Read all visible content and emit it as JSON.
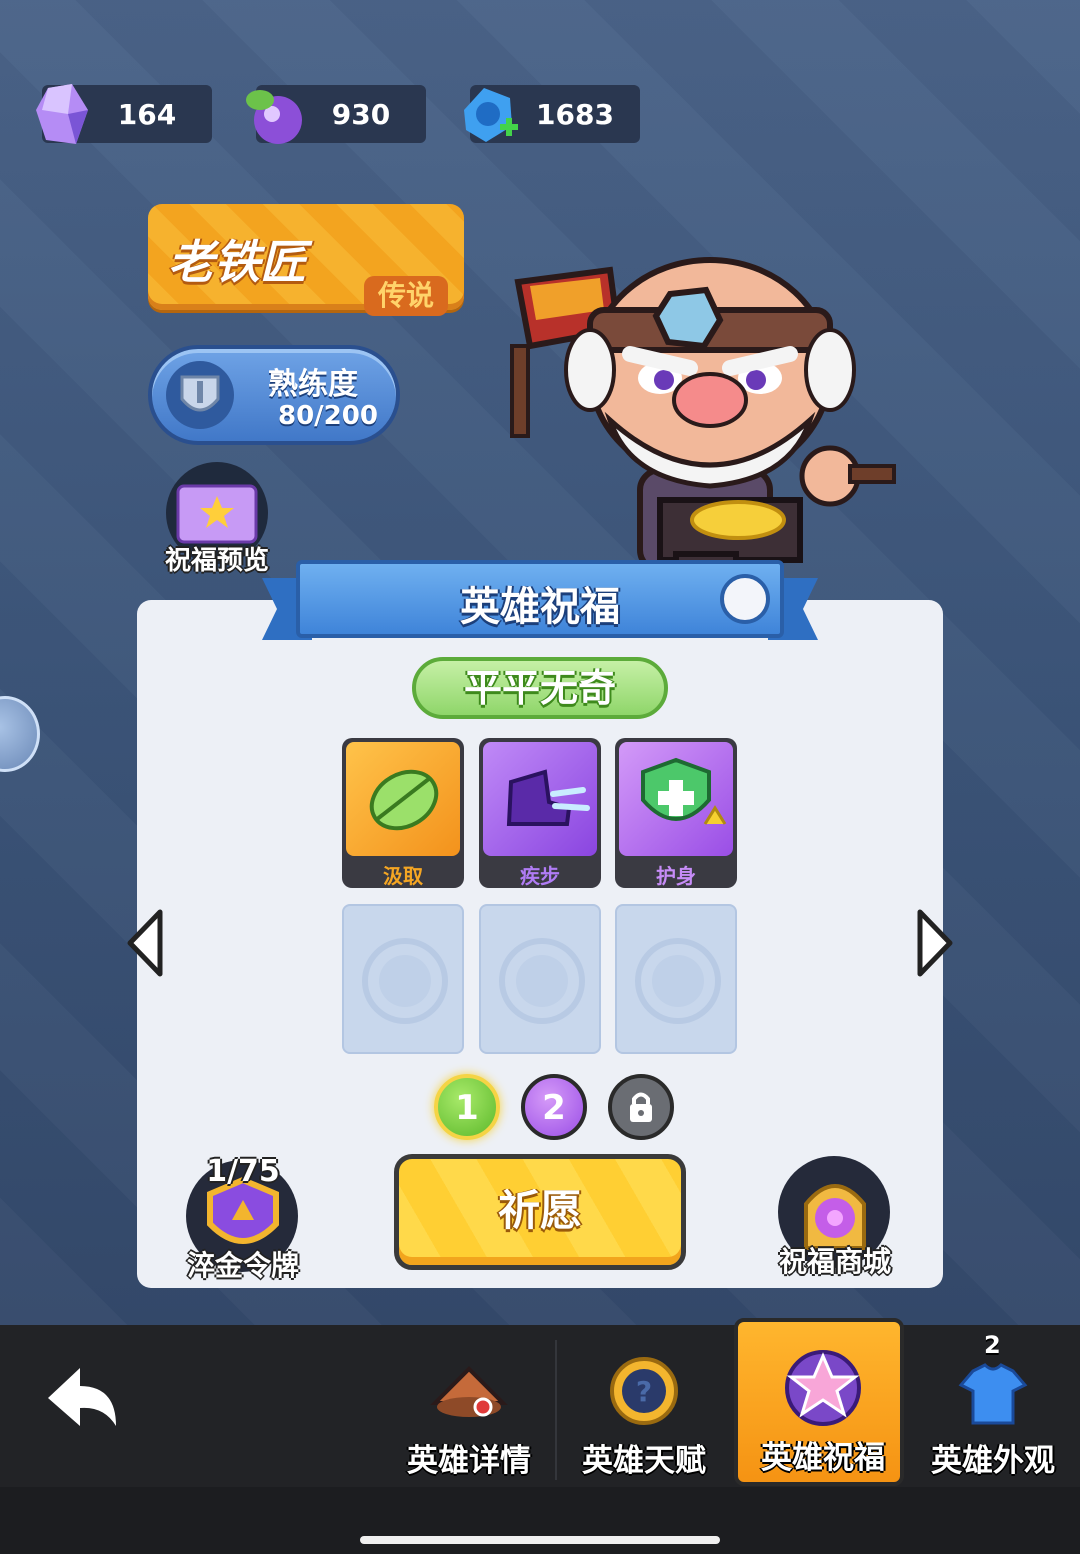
{
  "currencies": [
    {
      "icon": "crystal-icon",
      "value": "164"
    },
    {
      "icon": "potion-icon",
      "value": "930"
    },
    {
      "icon": "blue-gem-plus-icon",
      "value": "1683"
    }
  ],
  "hero": {
    "name": "老铁匠",
    "rarity": "传说",
    "proficiency_label": "熟练度",
    "proficiency_value": "80/200"
  },
  "preview_label": "祝福预览",
  "panel": {
    "title": "英雄祝福",
    "grade": "平平无奇",
    "skills": [
      {
        "label": "汲取",
        "icon": "leaf-icon",
        "color": "#f5a623"
      },
      {
        "label": "疾步",
        "icon": "boot-icon",
        "color": "#9a5cf0"
      },
      {
        "label": "护身",
        "icon": "shield-heal-icon",
        "color": "#b466f0"
      }
    ],
    "pages": [
      "1",
      "2"
    ],
    "pray_button": "祈愿",
    "token": {
      "count": "1/75",
      "label": "淬金令牌"
    },
    "shop_label": "祝福商城"
  },
  "nav": {
    "tabs": [
      {
        "label": "英雄详情",
        "icon": "hero-hat-icon",
        "active": false
      },
      {
        "label": "英雄天赋",
        "icon": "talent-medal-icon",
        "active": false
      },
      {
        "label": "英雄祝福",
        "icon": "blessing-star-icon",
        "active": true
      },
      {
        "label": "英雄外观",
        "icon": "shirt-icon",
        "active": false
      }
    ],
    "shirt_badge": "2"
  },
  "colors": {
    "accent": "#f59313",
    "panel": "#edf0f6",
    "background": "#3c5478"
  }
}
